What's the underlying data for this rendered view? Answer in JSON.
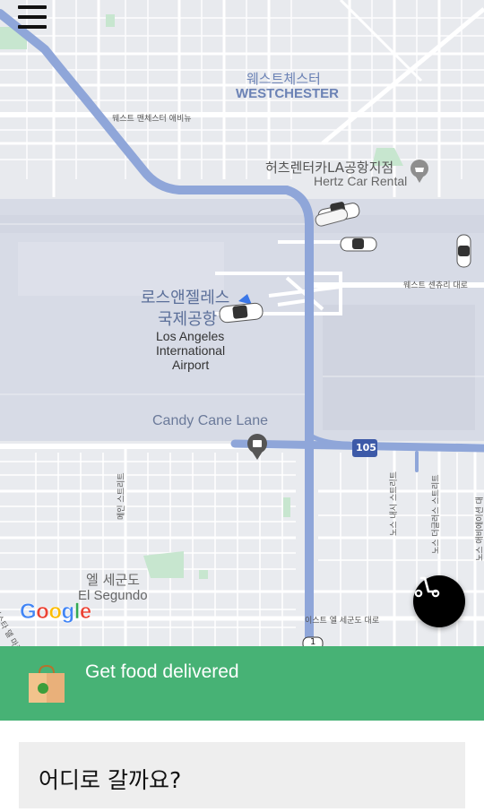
{
  "map": {
    "labels": {
      "westchester_ko": "웨스트체스터",
      "westchester_en": "WESTCHESTER",
      "avenue_top": "웨스트 맨체스터 애비뉴",
      "hertz_ko": "허츠렌터카LA공항지점",
      "hertz_en": "Hertz Car Rental",
      "century_blvd": "웨스트 센츄리 대로",
      "lax_ko_1": "로스앤젤레스",
      "lax_ko_2": "국제공항",
      "lax_en_1": "Los Angeles",
      "lax_en_2": "International",
      "lax_en_3": "Airport",
      "candy_cane": "Candy Cane Lane",
      "highway_105": "105",
      "highway_1": "1",
      "main_street": "메인 스트리트",
      "nash_street": "노스 내시 스트리트",
      "douglas_street": "노스 더글러스 스트리트",
      "aviation_blvd": "노스 애비에이션 대",
      "el_segundo_ko": "엘 세군도",
      "el_segundo_en": "El Segundo",
      "east_el_segundo": "이스트 엘 세군도 대로",
      "left_edge_road": "비스타 델 마르"
    },
    "google_logo": "Google",
    "icons": {
      "menu": "hamburger-menu-icon",
      "scooter": "scooter-icon",
      "car": "car-marker-icon",
      "pin": "place-pin-icon"
    }
  },
  "banner": {
    "text": "Get food delivered",
    "color": "#47b275"
  },
  "search": {
    "placeholder": "어디로 갈까요?"
  },
  "colors": {
    "highway": "#8fa6d9",
    "map_bg": "#e9ebef",
    "airport": "#d6dae6",
    "park": "#c7e6cf"
  }
}
